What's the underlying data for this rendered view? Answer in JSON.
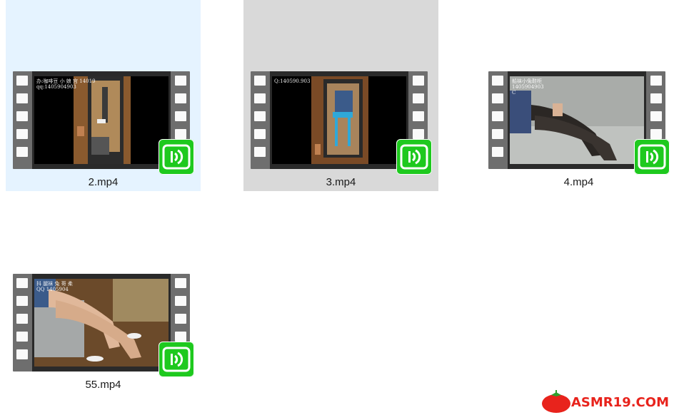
{
  "files": [
    {
      "name": "2.mp4",
      "state": "hover",
      "overlay": "办:咖啡豆 小 娘 宫 14019\nqq:1405904903"
    },
    {
      "name": "3.mp4",
      "state": "selected",
      "overlay": "Q:140590.903"
    },
    {
      "name": "4.mp4",
      "state": "normal",
      "overlay": "船袜小兔鞋柜\n1405904903\nC"
    },
    {
      "name": "55.mp4",
      "state": "normal",
      "overlay": "抖 腿袜 兔 哥 柔\nQQ 1405904"
    }
  ],
  "watermark": {
    "text": "ASMR19.COM"
  },
  "colors": {
    "badge": "#1ec91e",
    "hover": "#e5f3ff",
    "selected": "#d9d9d9",
    "watermark": "#e8231c"
  },
  "icons": {
    "badge": "video-player-icon",
    "logo": "tomato-icon"
  }
}
